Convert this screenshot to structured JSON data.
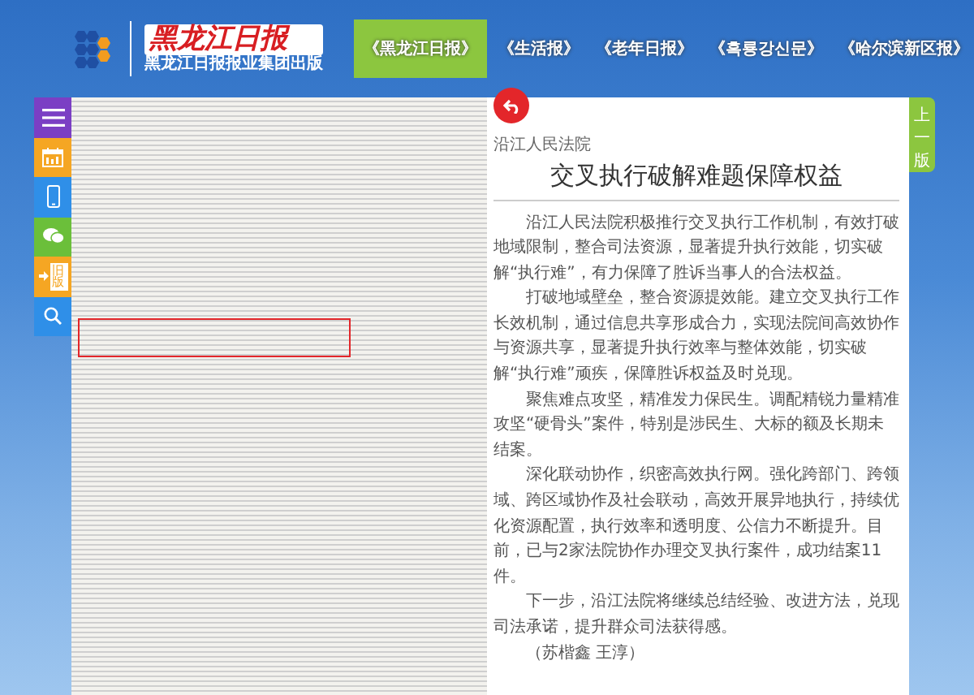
{
  "header": {
    "logo_title": "黑龙江日报",
    "logo_subtitle": "黑龙江日报报业集团出版"
  },
  "nav_tabs": [
    {
      "label": "《黑龙江日报》",
      "selected": true
    },
    {
      "label": "《生活报》",
      "selected": false
    },
    {
      "label": "《老年日报》",
      "selected": false
    },
    {
      "label": "《흑룡강신문》",
      "selected": false
    },
    {
      "label": "《哈尔滨新区报》",
      "selected": false
    }
  ],
  "sidebar": {
    "old_version_label": "旧版"
  },
  "page_nav": {
    "previous_page": "上一版"
  },
  "article": {
    "kicker": "沿江人民法院",
    "title": "交叉执行破解难题保障权益",
    "paragraphs": [
      "沿江人民法院积极推行交叉执行工作机制，有效打破地域限制，整合司法资源，显著提升执行效能，切实破解“执行难”，有力保障了胜诉当事人的合法权益。",
      "打破地域壁垒，整合资源提效能。建立交叉执行工作长效机制，通过信息共享形成合力，实现法院间高效协作与资源共享，显著提升执行效率与整体效能，切实破解“执行难”顽疾，保障胜诉权益及时兑现。",
      "聚焦难点攻坚，精准发力保民生。调配精锐力量精准攻坚“硬骨头”案件，特别是涉民生、大标的额及长期未结案。",
      "深化联动协作，织密高效执行网。强化跨部门、跨领域、跨区域协作及社会联动，高效开展异地执行，持续优化资源配置，执行效率和透明度、公信力不断提升。目前，已与2家法院协作办理交叉执行案件，成功结案11件。",
      "下一步，沿江法院将继续总结经验、改进方法，兑现司法承诺，提升群众司法获得感。",
      "（苏楷鑫 王淳）"
    ]
  }
}
